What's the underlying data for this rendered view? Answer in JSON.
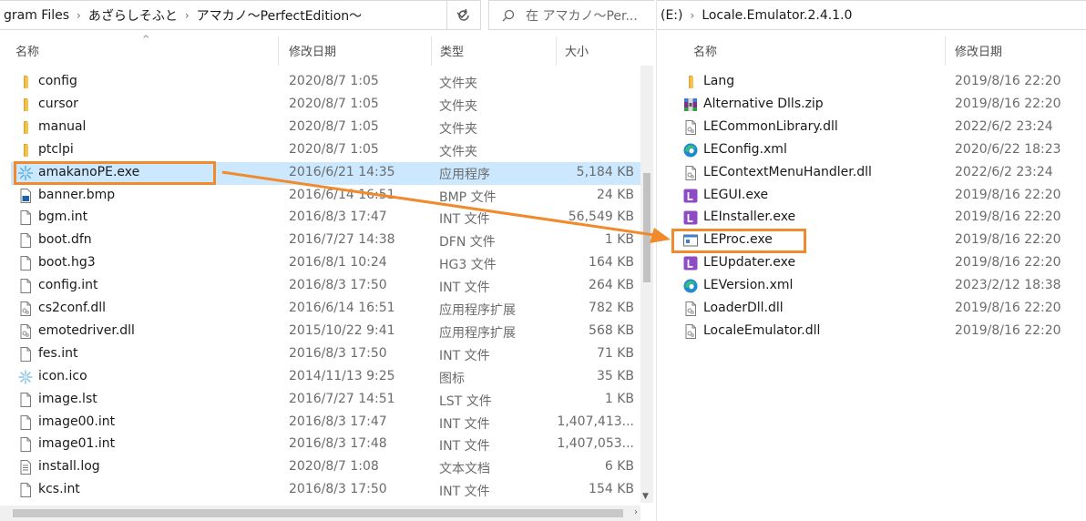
{
  "left": {
    "breadcrumbs": [
      "gram Files",
      "あざらしそふと",
      "アマカノ～PerfectEdition～"
    ],
    "search_placeholder": "在 アマカノ～Per...",
    "columns": {
      "name": "名称",
      "date": "修改日期",
      "type": "类型",
      "size": "大小"
    },
    "files": [
      {
        "name": "config",
        "date": "2020/8/7 1:05",
        "type": "文件夹",
        "size": "",
        "icon": "folder-icon"
      },
      {
        "name": "cursor",
        "date": "2020/8/7 1:05",
        "type": "文件夹",
        "size": "",
        "icon": "folder-icon"
      },
      {
        "name": "manual",
        "date": "2020/8/7 1:05",
        "type": "文件夹",
        "size": "",
        "icon": "folder-icon"
      },
      {
        "name": "ptclpi",
        "date": "2020/8/7 1:05",
        "type": "文件夹",
        "size": "",
        "icon": "folder-icon"
      },
      {
        "name": "amakanoPE.exe",
        "date": "2016/6/21 14:35",
        "type": "应用程序",
        "size": "5,184 KB",
        "icon": "app-exe-icon"
      },
      {
        "name": "banner.bmp",
        "date": "2016/6/14 16:51",
        "type": "BMP 文件",
        "size": "24 KB",
        "icon": "image-file-icon"
      },
      {
        "name": "bgm.int",
        "date": "2016/8/3 17:47",
        "type": "INT 文件",
        "size": "56,549 KB",
        "icon": "file-icon"
      },
      {
        "name": "boot.dfn",
        "date": "2016/7/27 14:38",
        "type": "DFN 文件",
        "size": "1 KB",
        "icon": "file-icon"
      },
      {
        "name": "boot.hg3",
        "date": "2016/8/1 10:24",
        "type": "HG3 文件",
        "size": "164 KB",
        "icon": "file-icon"
      },
      {
        "name": "config.int",
        "date": "2016/8/3 17:50",
        "type": "INT 文件",
        "size": "264 KB",
        "icon": "file-icon"
      },
      {
        "name": "cs2conf.dll",
        "date": "2016/6/14 16:51",
        "type": "应用程序扩展",
        "size": "782 KB",
        "icon": "dll-icon"
      },
      {
        "name": "emotedriver.dll",
        "date": "2015/10/22 9:41",
        "type": "应用程序扩展",
        "size": "568 KB",
        "icon": "dll-icon"
      },
      {
        "name": "fes.int",
        "date": "2016/8/3 17:50",
        "type": "INT 文件",
        "size": "71 KB",
        "icon": "file-icon"
      },
      {
        "name": "icon.ico",
        "date": "2014/11/13 9:25",
        "type": "图标",
        "size": "35 KB",
        "icon": "ico-icon"
      },
      {
        "name": "image.lst",
        "date": "2016/7/27 14:51",
        "type": "LST 文件",
        "size": "1 KB",
        "icon": "file-icon"
      },
      {
        "name": "image00.int",
        "date": "2016/8/3 17:47",
        "type": "INT 文件",
        "size": "1,407,413...",
        "icon": "file-icon"
      },
      {
        "name": "image01.int",
        "date": "2016/8/3 17:48",
        "type": "INT 文件",
        "size": "1,407,053...",
        "icon": "file-icon"
      },
      {
        "name": "install.log",
        "date": "2020/8/7 1:08",
        "type": "文本文档",
        "size": "6 KB",
        "icon": "text-file-icon"
      },
      {
        "name": "kcs.int",
        "date": "2016/8/3 17:50",
        "type": "INT 文件",
        "size": "154 KB",
        "icon": "file-icon"
      }
    ]
  },
  "right": {
    "breadcrumbs": [
      "(E:)",
      "Locale.Emulator.2.4.1.0"
    ],
    "columns": {
      "name": "名称",
      "date": "修改日期"
    },
    "files": [
      {
        "name": "Lang",
        "date": "2019/8/16 22:20",
        "icon": "folder-icon"
      },
      {
        "name": "Alternative Dlls.zip",
        "date": "2019/8/16 22:20",
        "icon": "zip-archive-icon"
      },
      {
        "name": "LECommonLibrary.dll",
        "date": "2022/6/2 23:24",
        "icon": "dll-icon"
      },
      {
        "name": "LEConfig.xml",
        "date": "2020/6/22 18:23",
        "icon": "edge-icon"
      },
      {
        "name": "LEContextMenuHandler.dll",
        "date": "2022/6/2 23:24",
        "icon": "dll-icon"
      },
      {
        "name": "LEGUI.exe",
        "date": "2019/8/16 22:20",
        "icon": "le-app-icon"
      },
      {
        "name": "LEInstaller.exe",
        "date": "2019/8/16 22:20",
        "icon": "le-app-icon"
      },
      {
        "name": "LEProc.exe",
        "date": "2019/8/16 22:20",
        "icon": "window-app-icon"
      },
      {
        "name": "LEUpdater.exe",
        "date": "2019/8/16 22:20",
        "icon": "le-app-icon"
      },
      {
        "name": "LEVersion.xml",
        "date": "2023/2/12 18:38",
        "icon": "edge-icon"
      },
      {
        "name": "LoaderDll.dll",
        "date": "2019/8/16 22:20",
        "icon": "dll-icon"
      },
      {
        "name": "LocaleEmulator.dll",
        "date": "2019/8/16 22:20",
        "icon": "dll-icon"
      }
    ]
  },
  "annotation": {
    "color": "#f08a2c",
    "source_file": "amakanoPE.exe",
    "target_file": "LEProc.exe"
  }
}
